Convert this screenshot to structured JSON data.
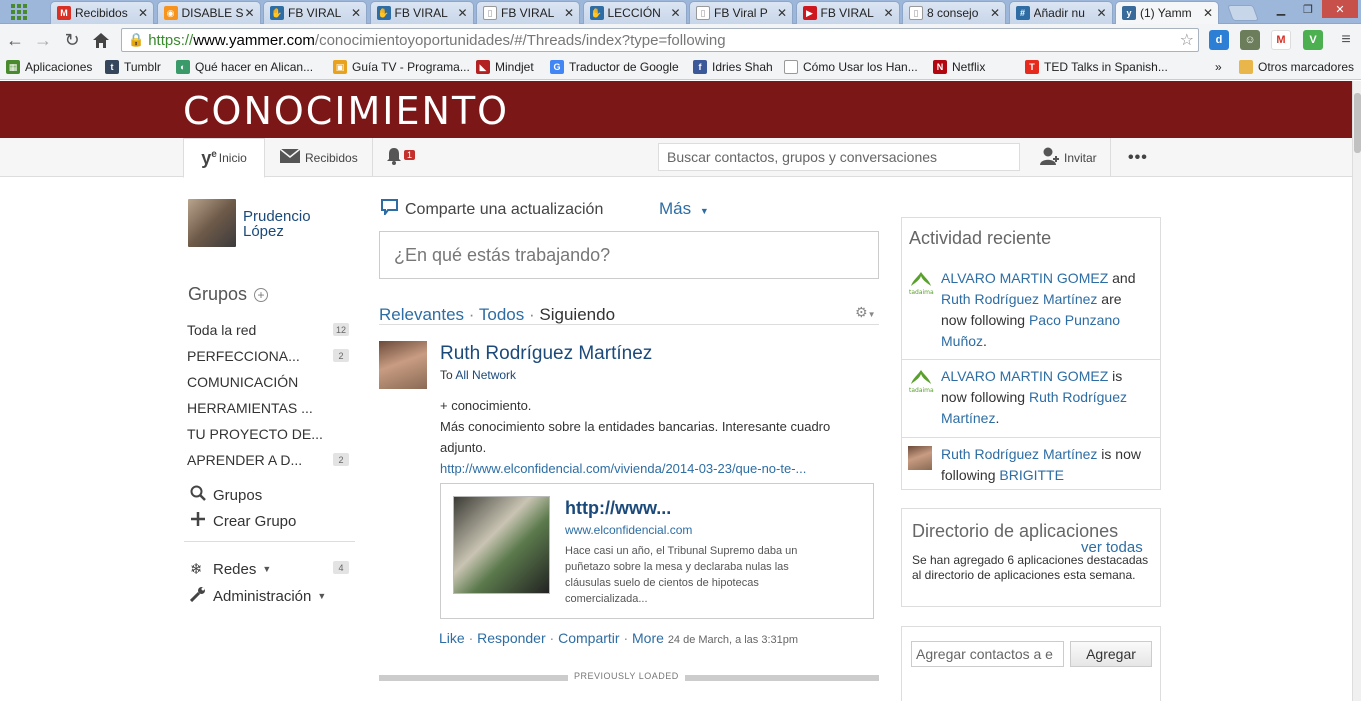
{
  "browser": {
    "tabs": [
      {
        "label": "Recibidos",
        "icon": "gmail-icon",
        "color": "#d93025"
      },
      {
        "label": "DISABLE S",
        "icon": "rss-icon",
        "color": "#f7941d"
      },
      {
        "label": "FB VIRAL",
        "icon": "hand-icon",
        "color": "#2d6da3"
      },
      {
        "label": "FB VIRAL",
        "icon": "hand-icon",
        "color": "#2d6da3"
      },
      {
        "label": "FB VIRAL",
        "icon": "page-icon",
        "color": "#999999"
      },
      {
        "label": "LECCIÓN",
        "icon": "hand-icon",
        "color": "#2d6da3"
      },
      {
        "label": "FB Viral P",
        "icon": "page-icon",
        "color": "#999999"
      },
      {
        "label": "FB VIRAL",
        "icon": "youtube-icon",
        "color": "#cc181e"
      },
      {
        "label": "8 consejo",
        "icon": "page-icon",
        "color": "#999999"
      },
      {
        "label": "Añadir nu",
        "icon": "hashtag-icon",
        "color": "#2d6da3"
      },
      {
        "label": "(1) Yamm",
        "icon": "yammer-icon",
        "color": "#396b9a"
      }
    ],
    "url_https": "https://",
    "url_host": "www.yammer.com",
    "url_path": "/conocimientoyoportunidades/#/Threads/index?type=following",
    "bookmarks": [
      {
        "label": "Aplicaciones",
        "icon": "apps-icon"
      },
      {
        "label": "Tumblr",
        "icon": "tumblr-icon"
      },
      {
        "label": "Qué hacer en Alican...",
        "icon": "globe-icon"
      },
      {
        "label": "Guía TV - Programa...",
        "icon": "tv-icon"
      },
      {
        "label": "Mindjet",
        "icon": "mindjet-icon"
      },
      {
        "label": "Traductor de Google",
        "icon": "translate-icon"
      },
      {
        "label": "Idries Shah",
        "icon": "facebook-icon"
      },
      {
        "label": "Cómo Usar los Han...",
        "icon": "page-icon"
      },
      {
        "label": "Netflix",
        "icon": "netflix-icon"
      },
      {
        "label": "TED Talks in Spanish...",
        "icon": "ted-icon"
      },
      {
        "label": "»",
        "icon": ""
      },
      {
        "label": "Otros marcadores",
        "icon": "folder-icon"
      }
    ]
  },
  "network": {
    "title": "CONOCIMIENTO"
  },
  "nav": {
    "home": "Inicio",
    "inbox": "Recibidos",
    "notif_count": "1",
    "search_placeholder": "Buscar contactos, grupos y conversaciones",
    "invite": "Invitar",
    "more": "•••"
  },
  "sidebar": {
    "user_first": "Prudencio",
    "user_last": "López",
    "groups_heading": "Grupos",
    "groups": [
      {
        "name": "Toda la red",
        "count": "12"
      },
      {
        "name": "PERFECCIONA...",
        "count": "2"
      },
      {
        "name": "COMUNICACIÓN",
        "count": ""
      },
      {
        "name": "HERRAMIENTAS ...",
        "count": ""
      },
      {
        "name": "TU PROYECTO DE...",
        "count": ""
      },
      {
        "name": "APRENDER A D...",
        "count": "2"
      }
    ],
    "browse_groups": "Grupos",
    "create_group": "Crear Grupo",
    "networks": "Redes",
    "networks_count": "4",
    "admin": "Administración"
  },
  "feed": {
    "share_label": "Comparte una actualización",
    "more_label": "Más",
    "composer_placeholder": "¿En qué estás trabajando?",
    "filter_relevant": "Relevantes",
    "filter_all": "Todos",
    "filter_following": "Siguiendo",
    "post": {
      "author": "Ruth Rodríguez Martínez",
      "to_prefix": "To",
      "to_target": "All Network",
      "line1": "+ conocimiento.",
      "line2": "Más conocimiento sobre la entidades bancarias. Interesante cuadro adjunto.",
      "link": "http://www.elconfidencial.com/vivienda/2014-03-23/que-no-te-...",
      "attach_title": "http://www...",
      "attach_host": "www.elconfidencial.com",
      "attach_desc": "Hace casi un año, el Tribunal Supremo daba un puñetazo sobre la mesa y declaraba nulas las cláusulas suelo de cientos de hipotecas comercializada...",
      "like": "Like",
      "reply": "Responder",
      "share": "Compartir",
      "more": "More",
      "timestamp": "24 de March, a las 3:31pm"
    },
    "previously_loaded": "PREVIOUSLY LOADED"
  },
  "activity": {
    "heading": "Actividad reciente",
    "item1_a": "ALVARO MARTIN GOMEZ",
    "item1_and": "and",
    "item1_b": "Ruth Rodríguez Martínez",
    "item1_mid": "are now following",
    "item1_c": "Paco Punzano Muñoz",
    "item2_a": "ALVARO MARTIN GOMEZ",
    "item2_mid": "is now following",
    "item2_b": "Ruth Rodríguez Martínez",
    "item3_a": "Ruth Rodríguez Martínez",
    "item3_mid": "is now following",
    "item3_b": "BRIGITTE"
  },
  "directory": {
    "heading": "Directorio de aplicaciones",
    "see_all": "ver todas",
    "text": "Se han agregado 6 aplicaciones destacadas al directorio de aplicaciones esta semana."
  },
  "add_contacts": {
    "placeholder": "Agregar contactos a e",
    "button": "Agregar"
  }
}
